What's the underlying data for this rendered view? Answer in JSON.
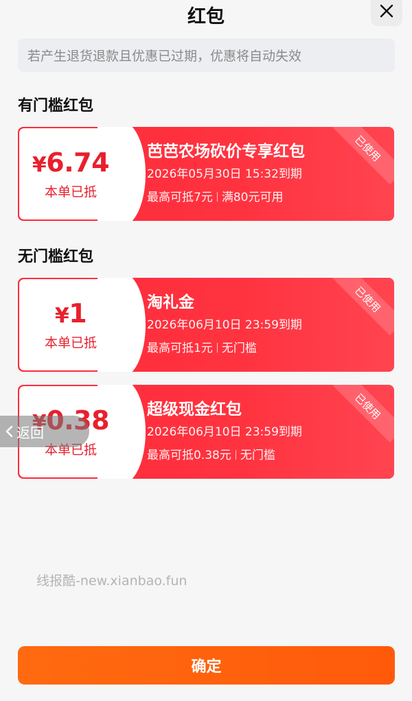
{
  "header": {
    "title": "红包",
    "close_icon": "close-icon"
  },
  "notice": "若产生退货退款且优惠已过期，优惠将自动失效",
  "sections": [
    {
      "title": "有门槛红包",
      "coupons": [
        {
          "currency": "¥",
          "amount": "6.74",
          "deducted": "本单已抵",
          "name": "芭芭农场砍价专享红包",
          "expire": "2026年05月30日 15:32到期",
          "rule_max": "最高可抵7元",
          "rule_threshold": "满80元可用",
          "status": "已使用"
        }
      ]
    },
    {
      "title": "无门槛红包",
      "coupons": [
        {
          "currency": "¥",
          "amount": "1",
          "deducted": "本单已抵",
          "name": "淘礼金",
          "expire": "2026年06月10日 23:59到期",
          "rule_max": "最高可抵1元",
          "rule_threshold": "无门槛",
          "status": "已使用"
        },
        {
          "currency": "¥",
          "amount": "0.38",
          "deducted": "本单已抵",
          "name": "超级现金红包",
          "expire": "2026年06月10日 23:59到期",
          "rule_max": "最高可抵0.38元",
          "rule_threshold": "无门槛",
          "status": "已使用"
        }
      ]
    }
  ],
  "back_button": {
    "label": "返回",
    "icon": "chevron-left-icon"
  },
  "watermark": "线报酷-new.xianbao.fun",
  "confirm_button": "确定",
  "colors": {
    "coupon_red": "#ff2a3a",
    "amount_red": "#e8202e",
    "confirm_orange": "#ff6a10"
  }
}
